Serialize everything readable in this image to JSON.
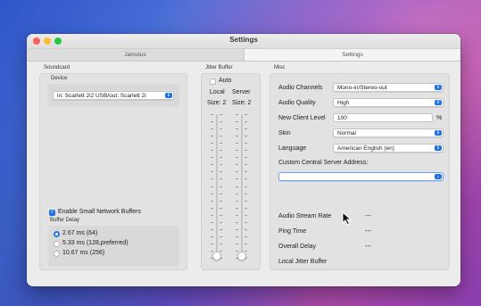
{
  "window": {
    "title": "Settings"
  },
  "tabs": [
    {
      "label": "Jamulus",
      "active": false
    },
    {
      "label": "Settings",
      "active": true
    }
  ],
  "soundcard": {
    "section_label": "Soundcard",
    "device_label": "Device",
    "device_value": "in: Scarlett 2i2 USB/out: Scarlett 2i",
    "enable_small_buffers_label": "Enable Small Network Buffers",
    "enable_small_buffers_checked": true,
    "buffer_delay_label": "Buffer Delay",
    "buffer_options": [
      {
        "label": "2.67 ms (64)",
        "selected": true
      },
      {
        "label": "5.33 ms (128,preferred)",
        "selected": false
      },
      {
        "label": "10.67 ms (256)",
        "selected": false
      }
    ]
  },
  "jitter": {
    "section_label": "Jitter Buffer",
    "auto_label": "Auto",
    "auto_checked": false,
    "local_label": "Local",
    "server_label": "Server",
    "local_size_label": "Size: 2",
    "server_size_label": "Size: 2"
  },
  "misc": {
    "section_label": "Misc",
    "audio_channels_label": "Audio Channels",
    "audio_channels_value": "Mono-in/Stereo-out",
    "audio_quality_label": "Audio Quality",
    "audio_quality_value": "High",
    "new_client_level_label": "New Client Level",
    "new_client_level_value": "100",
    "new_client_level_unit": "%",
    "skin_label": "Skin",
    "skin_value": "Normal",
    "language_label": "Language",
    "language_value": "American English (en)",
    "custom_server_label": "Custom Central Server Address:",
    "custom_server_value": "",
    "stream_rate_label": "Audio Stream Rate",
    "stream_rate_value": "---",
    "ping_label": "Ping Time",
    "ping_value": "---",
    "overall_delay_label": "Overall Delay",
    "overall_delay_value": "---",
    "local_jitter_label": "Local Jitter Buffer"
  },
  "colors": {
    "accent": "#1f73e8",
    "close": "#fe5f57",
    "minimize": "#febc2e",
    "maximize": "#28c840"
  },
  "icons": [
    "close-icon",
    "minimize-icon",
    "maximize-icon",
    "chevron-updown-icon",
    "checkmark-icon",
    "mouse-pointer-icon"
  ]
}
